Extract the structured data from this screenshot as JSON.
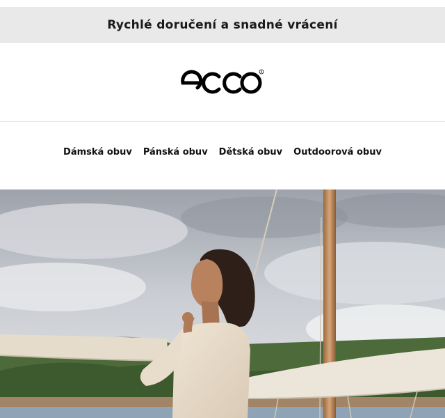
{
  "banner": {
    "text": "Rychlé doručení a snadné vrácení"
  },
  "brand": {
    "logo_text": "ecco",
    "logo_icon": "ecco-logo"
  },
  "nav": {
    "items": [
      {
        "label": "Dámská obuv"
      },
      {
        "label": "Pánská obuv"
      },
      {
        "label": "Dětská obuv"
      },
      {
        "label": "Outdoorová obuv"
      }
    ]
  },
  "hero": {
    "image": "woman-on-sailboat-photo"
  },
  "colors": {
    "banner_bg": "#e9e9e9",
    "text": "#111111",
    "logo": "#000000"
  }
}
